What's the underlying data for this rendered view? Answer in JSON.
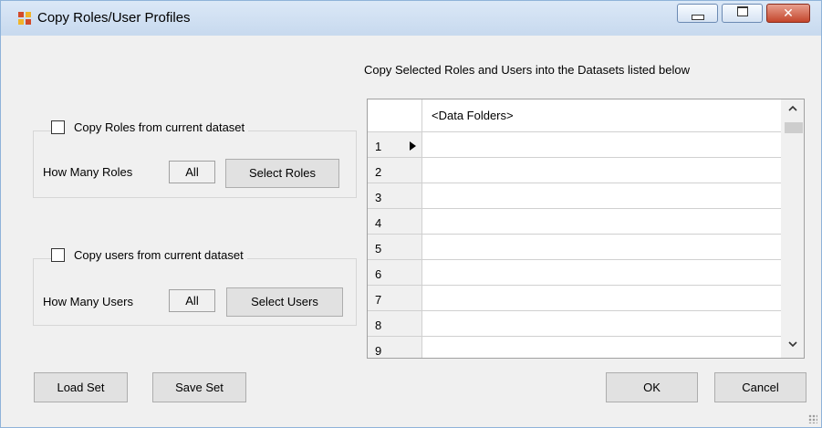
{
  "window": {
    "title": "Copy Roles/User Profiles"
  },
  "roles": {
    "checkbox_label": "Copy Roles from current dataset",
    "how_many_label": "How Many Roles",
    "how_many_value": "All",
    "select_button": "Select Roles"
  },
  "users": {
    "checkbox_label": "Copy users from current dataset",
    "how_many_label": "How Many Users",
    "how_many_value": "All",
    "select_button": "Select Users"
  },
  "datasets": {
    "heading": "Copy Selected Roles and Users into the Datasets listed below",
    "column_header": "<Data Folders>",
    "rows": [
      "1",
      "2",
      "3",
      "4",
      "5",
      "6",
      "7",
      "8",
      "9"
    ],
    "scroll_up": "^",
    "scroll_down": "v"
  },
  "buttons": {
    "load_set": "Load Set",
    "save_set": "Save Set",
    "ok": "OK",
    "cancel": "Cancel"
  }
}
